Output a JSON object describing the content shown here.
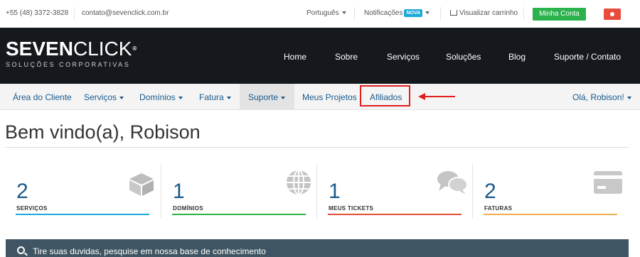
{
  "topbar": {
    "phone": "+55 (48) 3372-3828",
    "email": "contato@sevenclick.com.br",
    "language": "Português",
    "notifications": "Notificações",
    "notifications_badge": "NOVA",
    "cart": "Visualizar carrinho",
    "account_button": "Minha Conta",
    "account_button_color": "#2bb24c"
  },
  "brand": {
    "name_bold": "SEVEN",
    "name_thin": "CLICK",
    "registered": "®",
    "tagline": "SOLUÇÕES CORPORATIVAS"
  },
  "main_nav": [
    "Home",
    "Sobre",
    "Serviços",
    "Soluções",
    "Blog",
    "Suporte / Contato"
  ],
  "client_nav": {
    "items": [
      {
        "label": "Área do Cliente"
      },
      {
        "label": "Serviços"
      },
      {
        "label": "Domínios"
      },
      {
        "label": "Fatura"
      },
      {
        "label": "Suporte"
      },
      {
        "label": "Meus Projetos"
      },
      {
        "label": "Afiliados"
      }
    ],
    "user": "Olá, Robison!"
  },
  "page_title": "Bem vindo(a), Robison",
  "stats": [
    {
      "value": "2",
      "label": "SERVIÇOS",
      "icon": "box-icon",
      "color": "#1ba9d9"
    },
    {
      "value": "1",
      "label": "DOMÍNIOS",
      "icon": "globe-icon",
      "color": "#2bb24c"
    },
    {
      "value": "1",
      "label": "MEUS TICKETS",
      "icon": "chat-icon",
      "color": "#e74c3c"
    },
    {
      "value": "2",
      "label": "FATURAS",
      "icon": "credit-card-icon",
      "color": "#f0ad4e"
    }
  ],
  "knowledgebase": {
    "text": "Tire suas duvidas, pesquise em nossa base de conhecimento"
  }
}
